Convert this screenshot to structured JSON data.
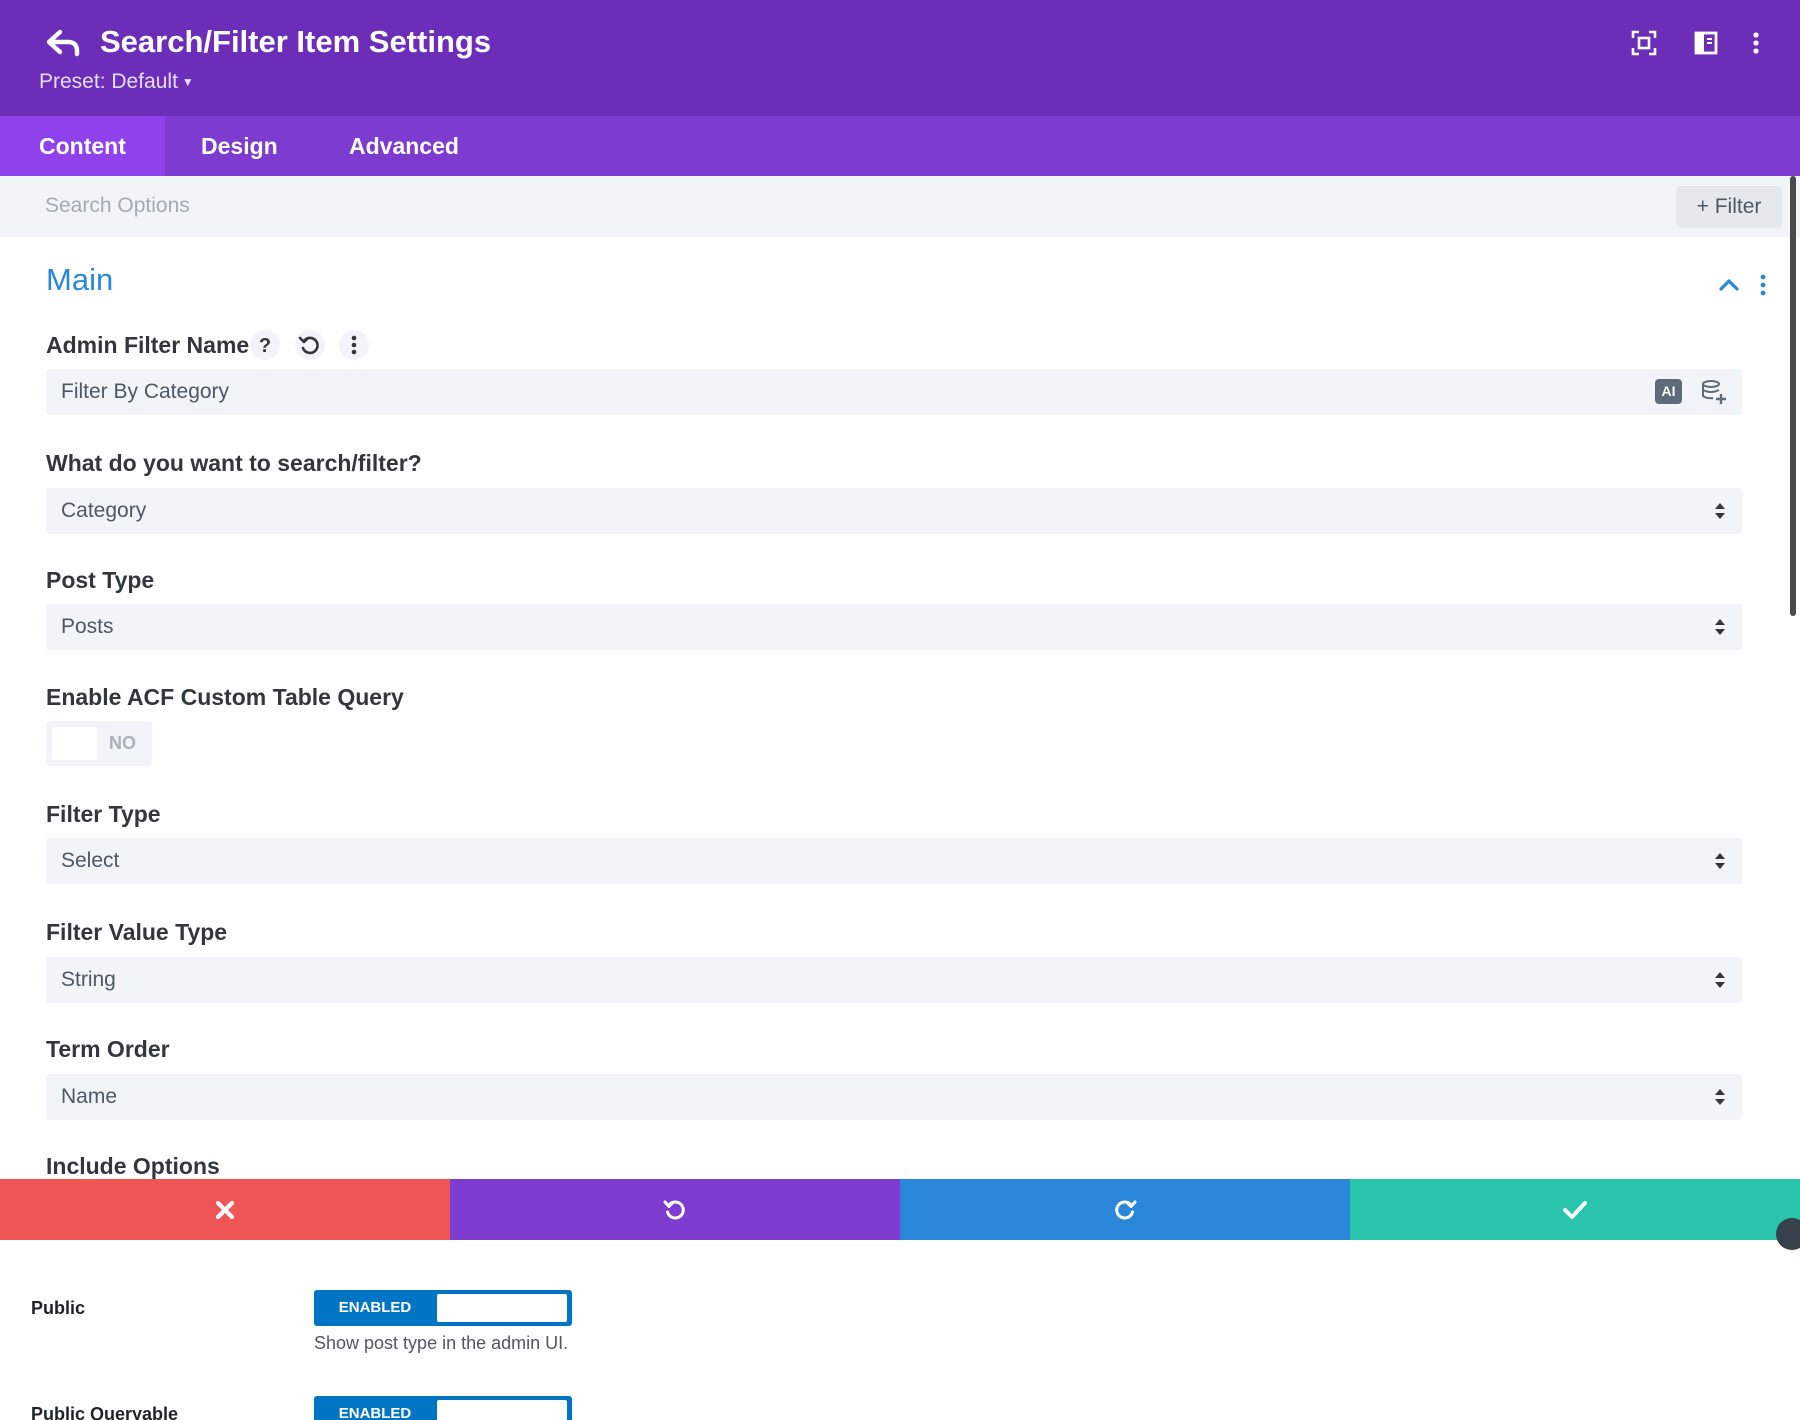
{
  "header": {
    "title": "Search/Filter Item Settings",
    "preset": "Preset: Default",
    "icons": [
      "back-icon",
      "fullscreen-icon",
      "split-view-icon",
      "more-vertical-icon"
    ]
  },
  "tabs": [
    {
      "label": "Content",
      "active": true
    },
    {
      "label": "Design",
      "active": false
    },
    {
      "label": "Advanced",
      "active": false
    }
  ],
  "search": {
    "placeholder": "Search Options",
    "filter_label": "+ Filter"
  },
  "section": {
    "title": "Main"
  },
  "fields": {
    "admin_filter_name": {
      "label": "Admin Filter Name",
      "value": "Filter By Category",
      "ai_label": "AI"
    },
    "search_filter": {
      "label": "What do you want to search/filter?",
      "value": "Category"
    },
    "post_type": {
      "label": "Post Type",
      "value": "Posts"
    },
    "acf_custom": {
      "label": "Enable ACF Custom Table Query",
      "toggle": "NO"
    },
    "filter_type": {
      "label": "Filter Type",
      "value": "Select"
    },
    "filter_value_type": {
      "label": "Filter Value Type",
      "value": "String"
    },
    "term_order": {
      "label": "Term Order",
      "value": "Name"
    },
    "include_options": {
      "label": "Include Options"
    }
  },
  "actions": [
    {
      "name": "discard",
      "color": "#ef5555"
    },
    {
      "name": "undo",
      "color": "#7e3bd0"
    },
    {
      "name": "redo",
      "color": "#2b87da"
    },
    {
      "name": "save",
      "color": "#29c4a9"
    }
  ],
  "page": {
    "public": {
      "label": "Public",
      "switch": "ENABLED",
      "help": "Show post type in the admin UI."
    },
    "public_queryable": {
      "label": "Public Queryable",
      "switch": "ENABLED"
    }
  }
}
